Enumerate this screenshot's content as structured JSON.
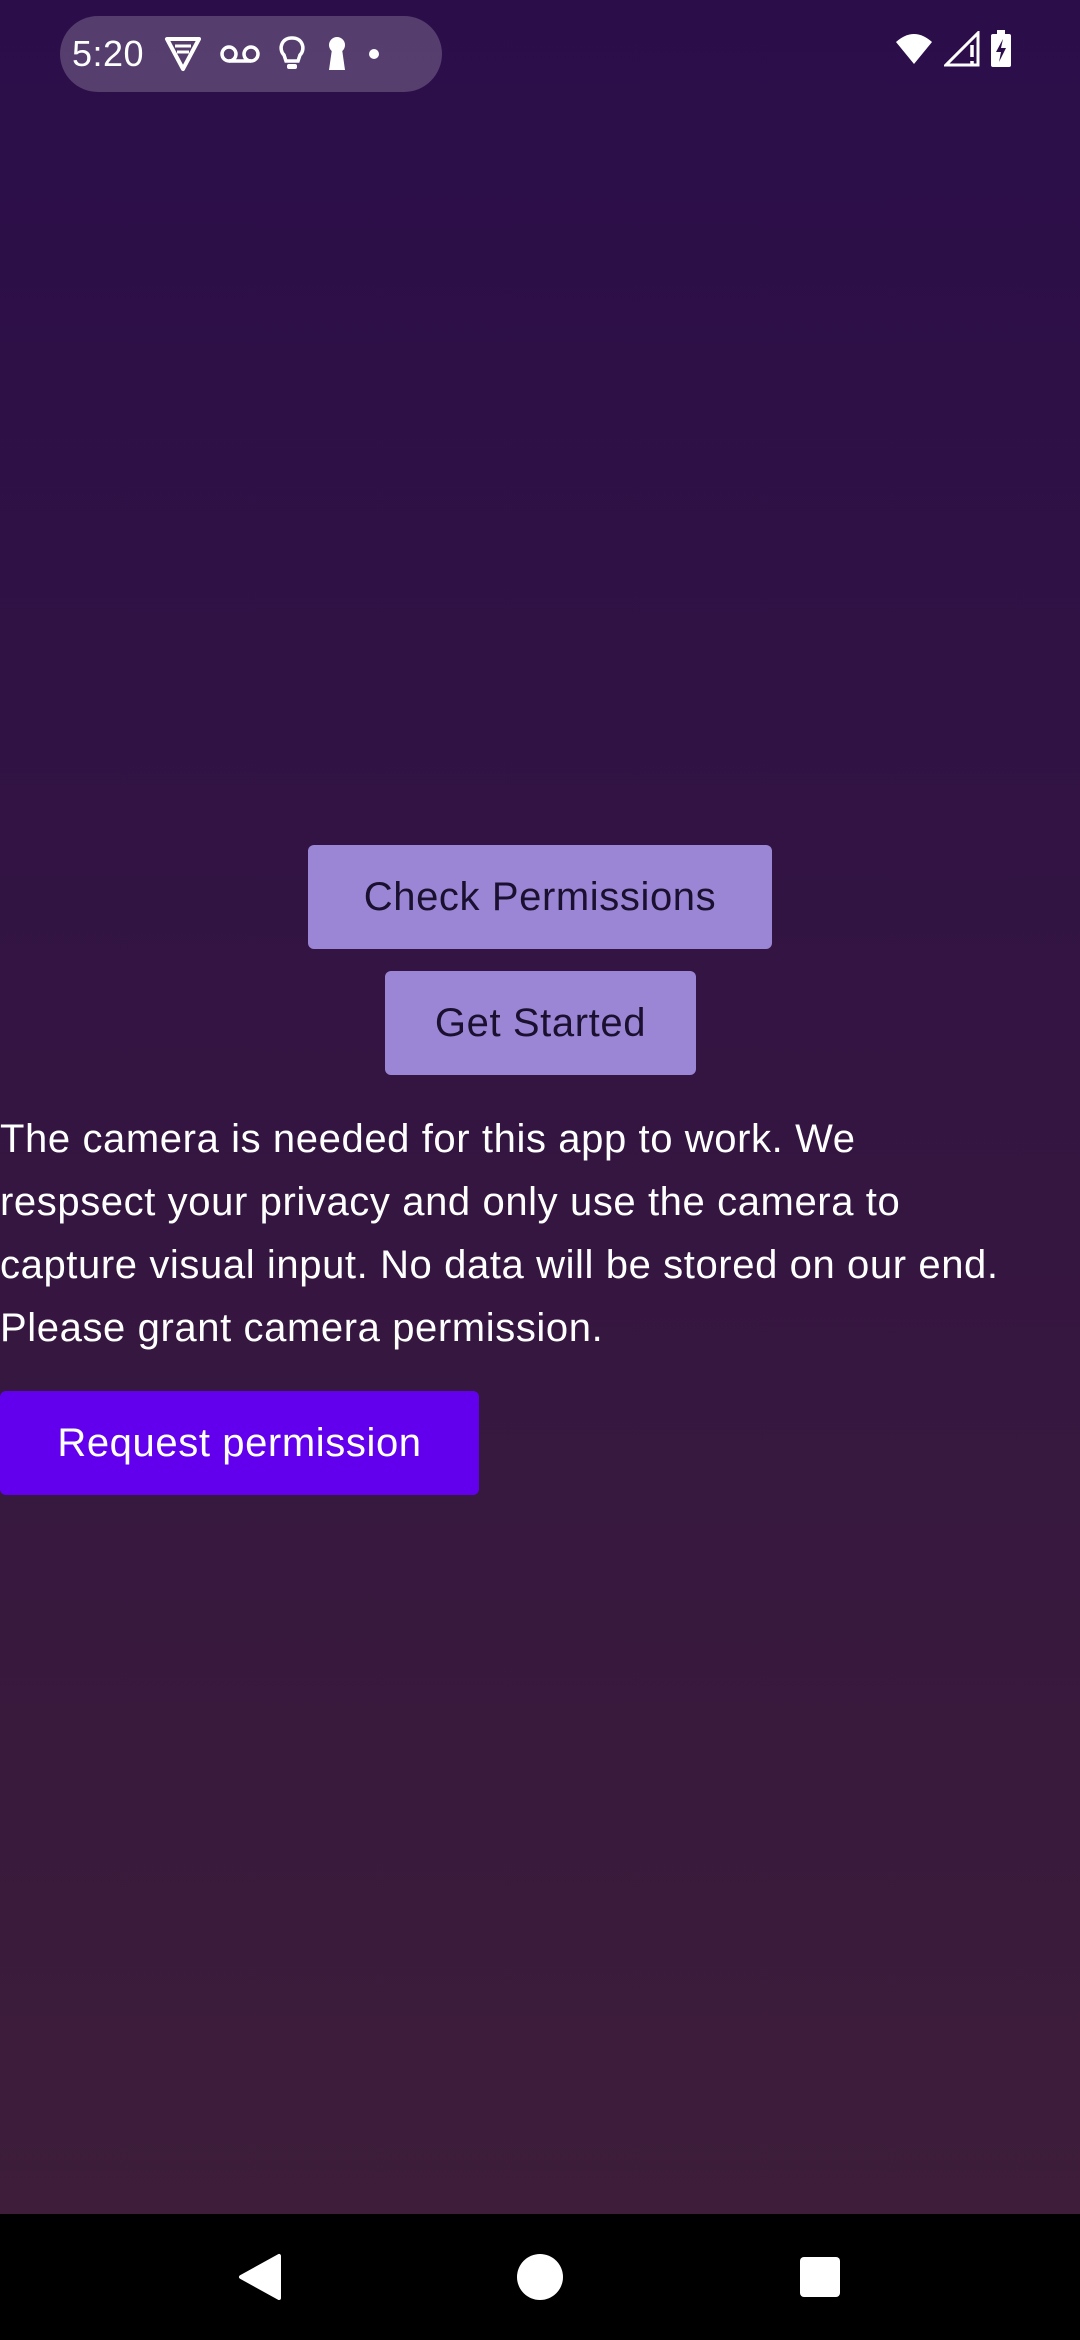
{
  "status_bar": {
    "time": "5:20",
    "left_icons": [
      "vpn-shield-icon",
      "voicemail-icon",
      "lightbulb-icon",
      "keyhole-icon",
      "dot-icon"
    ],
    "right_icons": [
      "wifi-icon",
      "cell-signal-icon",
      "battery-charging-icon"
    ]
  },
  "main": {
    "check_permissions_label": "Check Permissions",
    "get_started_label": "Get Started",
    "message_lines": [
      "The camera is needed for this app to work. We",
      "respsect your privacy and only use the camera to",
      "capture visual input. No data will be stored on our end.",
      "Please grant camera permission."
    ],
    "request_permission_label": "Request permission"
  },
  "colors": {
    "background_top": "#2b0d4a",
    "background_bottom": "#3e1e38",
    "secondary_button": "#9a86d5",
    "primary_button": "#6200ee",
    "nav_bar": "#000000"
  },
  "nav_bar": {
    "buttons": [
      "back-icon",
      "home-icon",
      "recents-icon"
    ]
  }
}
